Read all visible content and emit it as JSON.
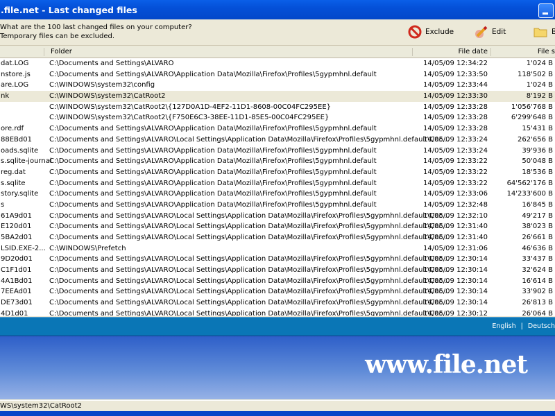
{
  "window": {
    "title": ".file.net - Last changed files"
  },
  "info": {
    "line1": "What are the 100 last changed files on your computer?",
    "line2": "Temporary files can be excluded."
  },
  "toolbar": {
    "exclude": "Exclude",
    "edit": "Edit",
    "browse": "B"
  },
  "columns": [
    "",
    "Folder",
    "File date",
    "File s"
  ],
  "rows": [
    [
      "dat.LOG",
      "C:\\Documents and Settings\\ALVARO",
      "14/05/09 12:34:22",
      "1'024 B"
    ],
    [
      "nstore.js",
      "C:\\Documents and Settings\\ALVARO\\Application Data\\Mozilla\\Firefox\\Profiles\\5gypmhnl.default",
      "14/05/09 12:33:50",
      "118'502 B"
    ],
    [
      "are.LOG",
      "C:\\WINDOWS\\system32\\config",
      "14/05/09 12:33:44",
      "1'024 B"
    ],
    [
      "nk",
      "C:\\WINDOWS\\system32\\CatRoot2",
      "14/05/09 12:33:30",
      "8'192 B"
    ],
    [
      "",
      "C:\\WINDOWS\\system32\\CatRoot2\\{127D0A1D-4EF2-11D1-8608-00C04FC295EE}",
      "14/05/09 12:33:28",
      "1'056'768 B"
    ],
    [
      "",
      "C:\\WINDOWS\\system32\\CatRoot2\\{F750E6C3-38EE-11D1-85E5-00C04FC295EE}",
      "14/05/09 12:33:28",
      "6'299'648 B"
    ],
    [
      "ore.rdf",
      "C:\\Documents and Settings\\ALVARO\\Application Data\\Mozilla\\Firefox\\Profiles\\5gypmhnl.default",
      "14/05/09 12:33:28",
      "15'431 B"
    ],
    [
      "88EBd01",
      "C:\\Documents and Settings\\ALVARO\\Local Settings\\Application Data\\Mozilla\\Firefox\\Profiles\\5gypmhnl.default\\Cac...",
      "14/05/09 12:33:24",
      "262'656 B"
    ],
    [
      "oads.sqlite",
      "C:\\Documents and Settings\\ALVARO\\Application Data\\Mozilla\\Firefox\\Profiles\\5gypmhnl.default",
      "14/05/09 12:33:24",
      "39'936 B"
    ],
    [
      "s.sqlite-journal",
      "C:\\Documents and Settings\\ALVARO\\Application Data\\Mozilla\\Firefox\\Profiles\\5gypmhnl.default",
      "14/05/09 12:33:22",
      "50'048 B"
    ],
    [
      "reg.dat",
      "C:\\Documents and Settings\\ALVARO\\Application Data\\Mozilla\\Firefox\\Profiles\\5gypmhnl.default",
      "14/05/09 12:33:22",
      "18'536 B"
    ],
    [
      "s.sqlite",
      "C:\\Documents and Settings\\ALVARO\\Application Data\\Mozilla\\Firefox\\Profiles\\5gypmhnl.default",
      "14/05/09 12:33:22",
      "64'562'176 B"
    ],
    [
      "story.sqlite",
      "C:\\Documents and Settings\\ALVARO\\Application Data\\Mozilla\\Firefox\\Profiles\\5gypmhnl.default",
      "14/05/09 12:33:06",
      "14'233'600 B"
    ],
    [
      "s",
      "C:\\Documents and Settings\\ALVARO\\Application Data\\Mozilla\\Firefox\\Profiles\\5gypmhnl.default",
      "14/05/09 12:32:48",
      "16'845 B"
    ],
    [
      "61A9d01",
      "C:\\Documents and Settings\\ALVARO\\Local Settings\\Application Data\\Mozilla\\Firefox\\Profiles\\5gypmhnl.default\\Cac...",
      "14/05/09 12:32:10",
      "49'217 B"
    ],
    [
      "E120d01",
      "C:\\Documents and Settings\\ALVARO\\Local Settings\\Application Data\\Mozilla\\Firefox\\Profiles\\5gypmhnl.default\\Cac...",
      "14/05/09 12:31:40",
      "38'023 B"
    ],
    [
      "5BA2d01",
      "C:\\Documents and Settings\\ALVARO\\Local Settings\\Application Data\\Mozilla\\Firefox\\Profiles\\5gypmhnl.default\\Cac...",
      "14/05/09 12:31:40",
      "26'661 B"
    ],
    [
      "LSID.EXE-2...",
      "C:\\WINDOWS\\Prefetch",
      "14/05/09 12:31:06",
      "46'636 B"
    ],
    [
      "9D20d01",
      "C:\\Documents and Settings\\ALVARO\\Local Settings\\Application Data\\Mozilla\\Firefox\\Profiles\\5gypmhnl.default\\Cac...",
      "14/05/09 12:30:14",
      "33'437 B"
    ],
    [
      "C1F1d01",
      "C:\\Documents and Settings\\ALVARO\\Local Settings\\Application Data\\Mozilla\\Firefox\\Profiles\\5gypmhnl.default\\Cac...",
      "14/05/09 12:30:14",
      "32'624 B"
    ],
    [
      "4A1Bd01",
      "C:\\Documents and Settings\\ALVARO\\Local Settings\\Application Data\\Mozilla\\Firefox\\Profiles\\5gypmhnl.default\\Cac...",
      "14/05/09 12:30:14",
      "16'614 B"
    ],
    [
      "7EEAd01",
      "C:\\Documents and Settings\\ALVARO\\Local Settings\\Application Data\\Mozilla\\Firefox\\Profiles\\5gypmhnl.default\\Cac...",
      "14/05/09 12:30:14",
      "33'902 B"
    ],
    [
      "DE73d01",
      "C:\\Documents and Settings\\ALVARO\\Local Settings\\Application Data\\Mozilla\\Firefox\\Profiles\\5gypmhnl.default\\Cac...",
      "14/05/09 12:30:14",
      "26'813 B"
    ],
    [
      "4D1d01",
      "C:\\Documents and Settings\\ALVARO\\Local Settings\\Application Data\\Mozilla\\Firefox\\Profiles\\5gypmhnl.default\\Cac...",
      "14/05/09 12:30:12",
      "26'064 B"
    ]
  ],
  "selected_row": 3,
  "languages": {
    "english": "English",
    "sep": "|",
    "deutsch": "Deutsch"
  },
  "banner": {
    "text": "www.file.net"
  },
  "status": {
    "text": "WS\\system32\\CatRoot2"
  },
  "colors": {
    "titlebar": "#0450d8",
    "selection": "#ece9d8",
    "langbar": "#0a76b6"
  }
}
